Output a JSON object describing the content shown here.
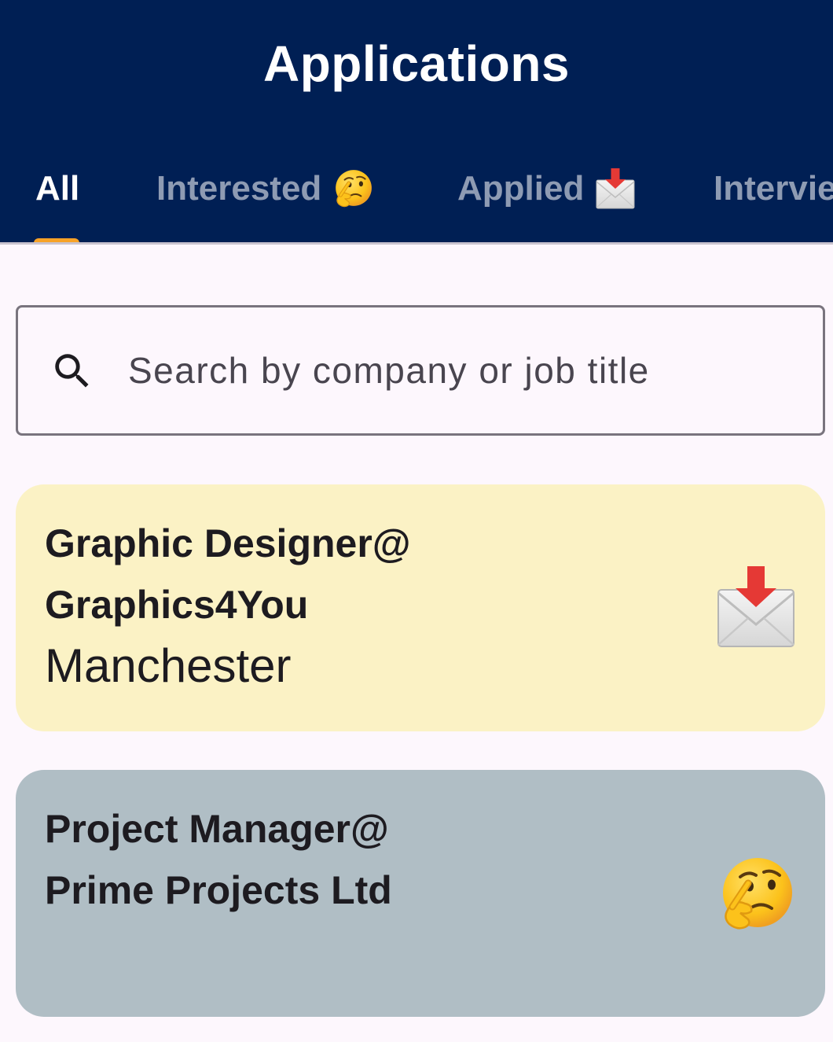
{
  "app_bar": {
    "title": "Applications",
    "background": "#001f54"
  },
  "tabs": [
    {
      "label": "All",
      "active": true,
      "icon": ""
    },
    {
      "label": "Interested",
      "active": false,
      "icon": "thinking-face-icon"
    },
    {
      "label": "Applied",
      "active": false,
      "icon": "envelope-arrow-icon"
    },
    {
      "label": "Intervie",
      "active": false,
      "icon": ""
    }
  ],
  "accent_color": "#f7a227",
  "search": {
    "placeholder": "Search by company or job title",
    "value": ""
  },
  "applications": [
    {
      "title_line1": "Graphic Designer@",
      "title_line2": "Graphics4You",
      "location": "Manchester",
      "status_icon": "envelope-arrow-icon",
      "background": "#fbf2c5"
    },
    {
      "title_line1": "Project Manager@",
      "title_line2": "Prime Projects Ltd",
      "location": "",
      "status_icon": "thinking-face-icon",
      "background": "#b0bec5"
    }
  ]
}
